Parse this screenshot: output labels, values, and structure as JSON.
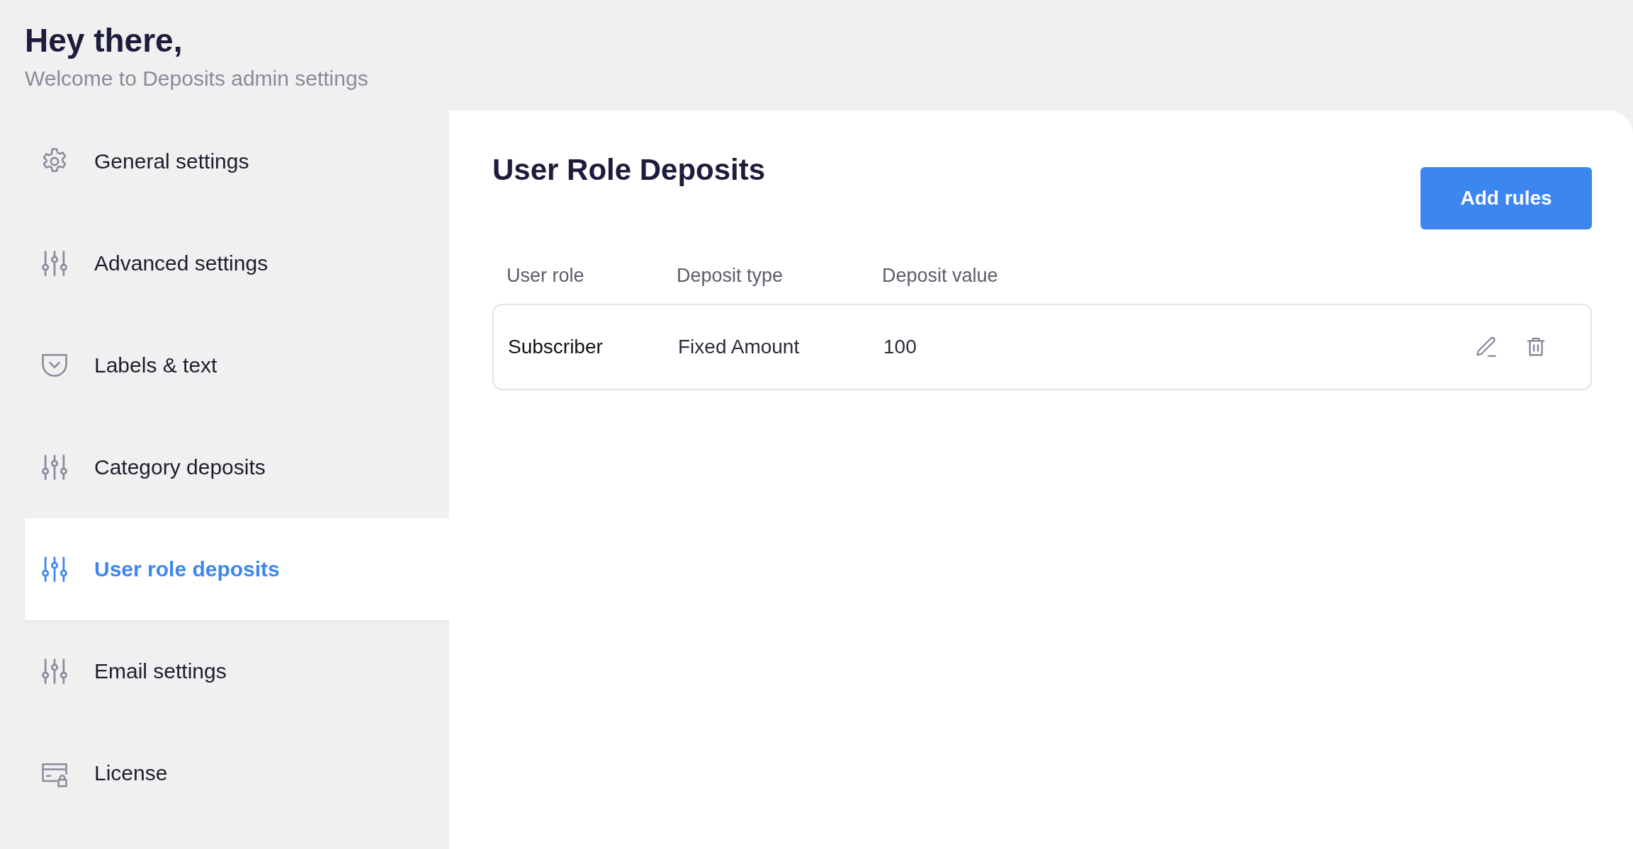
{
  "header": {
    "title": "Hey there,",
    "subtitle": "Welcome to Deposits admin settings"
  },
  "sidebar": {
    "items": [
      {
        "label": "General settings",
        "kind": "gear",
        "selected": false
      },
      {
        "label": "Advanced settings",
        "kind": "sliders",
        "selected": false
      },
      {
        "label": "Labels & text",
        "kind": "tag",
        "selected": false
      },
      {
        "label": "Category deposits",
        "kind": "sliders",
        "selected": false
      },
      {
        "label": "User role deposits",
        "kind": "sliders",
        "selected": true
      },
      {
        "label": "Email settings",
        "kind": "sliders",
        "selected": false
      },
      {
        "label": "License",
        "kind": "card",
        "selected": false
      }
    ]
  },
  "panel": {
    "title": "User Role Deposits",
    "add_button": "Add rules",
    "table": {
      "columns": [
        "User role",
        "Deposit type",
        "Deposit value"
      ],
      "rows": [
        {
          "cells": [
            "Subscriber",
            "Fixed Amount",
            "100"
          ]
        }
      ]
    }
  }
}
